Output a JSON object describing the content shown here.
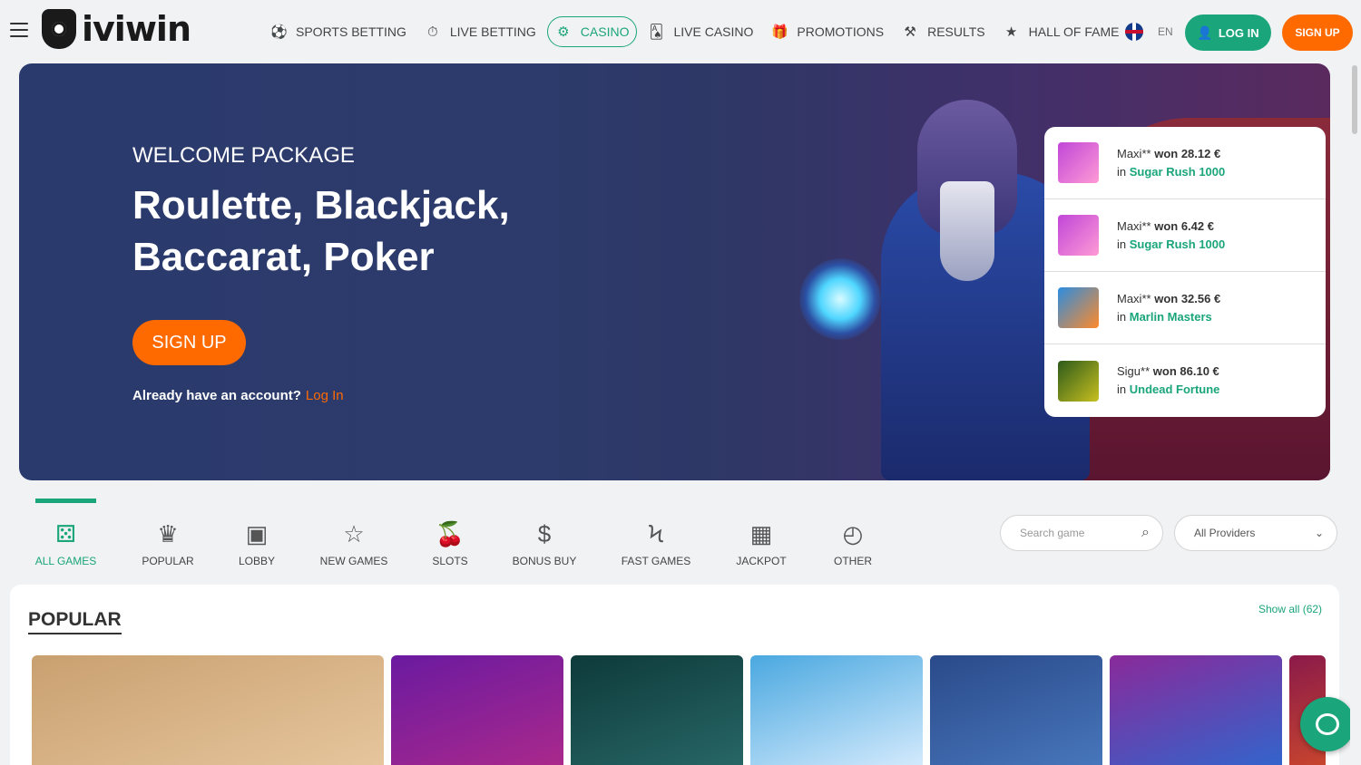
{
  "header": {
    "logo_text": "iviwin",
    "nav": [
      {
        "label": "SPORTS BETTING",
        "icon": "soccer-ball-icon",
        "glyph": "⚽"
      },
      {
        "label": "LIVE BETTING",
        "icon": "stopwatch-icon",
        "glyph": "⏱"
      },
      {
        "label": "CASINO",
        "icon": "casino-chip-icon",
        "glyph": "⚙",
        "active": true
      },
      {
        "label": "LIVE CASINO",
        "icon": "playing-cards-icon",
        "glyph": "🂡"
      },
      {
        "label": "PROMOTIONS",
        "icon": "gift-icon",
        "glyph": "🎁"
      },
      {
        "label": "RESULTS",
        "icon": "results-icon",
        "glyph": "⚒"
      },
      {
        "label": "HALL OF FAME",
        "icon": "podium-icon",
        "glyph": "★"
      }
    ],
    "lang": "EN",
    "login_label": "LOG IN",
    "signup_label": "SIGN UP"
  },
  "hero": {
    "subtitle": "WELCOME PACKAGE",
    "title": "Roulette, Blackjack, Baccarat, Poker",
    "signup_label": "SIGN UP",
    "account_text": "Already have an account?",
    "login_link": "Log In"
  },
  "winners": [
    {
      "user": "Maxi**",
      "won_word": "won",
      "amount": "28.12 €",
      "in_word": "in",
      "game": "Sugar Rush 1000",
      "color1": "#c046d8",
      "color2": "#ff9ad6"
    },
    {
      "user": "Maxi**",
      "won_word": "won",
      "amount": "6.42 €",
      "in_word": "in",
      "game": "Sugar Rush 1000",
      "color1": "#c046d8",
      "color2": "#ff9ad6"
    },
    {
      "user": "Maxi**",
      "won_word": "won",
      "amount": "32.56 €",
      "in_word": "in",
      "game": "Marlin Masters",
      "color1": "#2c8de0",
      "color2": "#ff8a2a"
    },
    {
      "user": "Sigu**",
      "won_word": "won",
      "amount": "86.10 €",
      "in_word": "in",
      "game": "Undead Fortune",
      "color1": "#2c5a1a",
      "color2": "#c8c020"
    }
  ],
  "categories": [
    {
      "label": "ALL GAMES",
      "icon": "dice-icon",
      "glyph": "⚄",
      "active": true
    },
    {
      "label": "POPULAR",
      "icon": "crown-icon",
      "glyph": "♛"
    },
    {
      "label": "LOBBY",
      "icon": "lobby-icon",
      "glyph": "▣"
    },
    {
      "label": "NEW GAMES",
      "icon": "star-icon",
      "glyph": "☆"
    },
    {
      "label": "SLOTS",
      "icon": "cherries-icon",
      "glyph": "🍒"
    },
    {
      "label": "BONUS BUY",
      "icon": "money-bag-icon",
      "glyph": "$"
    },
    {
      "label": "FAST GAMES",
      "icon": "lightning-icon",
      "glyph": "ϟ"
    },
    {
      "label": "JACKPOT",
      "icon": "slot-machine-icon",
      "glyph": "▦"
    },
    {
      "label": "OTHER",
      "icon": "stopwatch-icon",
      "glyph": "◴"
    }
  ],
  "search": {
    "placeholder": "Search game"
  },
  "providers": {
    "selected": "All Providers"
  },
  "popular": {
    "title": "POPULAR",
    "show_all": "Show all (62)",
    "games": [
      {
        "name": "zeus-game",
        "color1": "#c9a070",
        "color2": "#e8c8a0"
      },
      {
        "name": "seven-boost-game",
        "color1": "#6a1aa0",
        "color2": "#b02a8a"
      },
      {
        "name": "clown-game",
        "color1": "#0e3a3a",
        "color2": "#2a6a6a"
      },
      {
        "name": "zeus-comic-game",
        "color1": "#4aa8e0",
        "color2": "#e0f0ff"
      },
      {
        "name": "wolf-game",
        "color1": "#2a4a8a",
        "color2": "#4a7ac0"
      },
      {
        "name": "wolf-woman-game",
        "color1": "#8a2a9a",
        "color2": "#2a6ad0"
      },
      {
        "name": "partial-game",
        "color1": "#8a1a4a",
        "color2": "#d04a2a"
      }
    ]
  }
}
